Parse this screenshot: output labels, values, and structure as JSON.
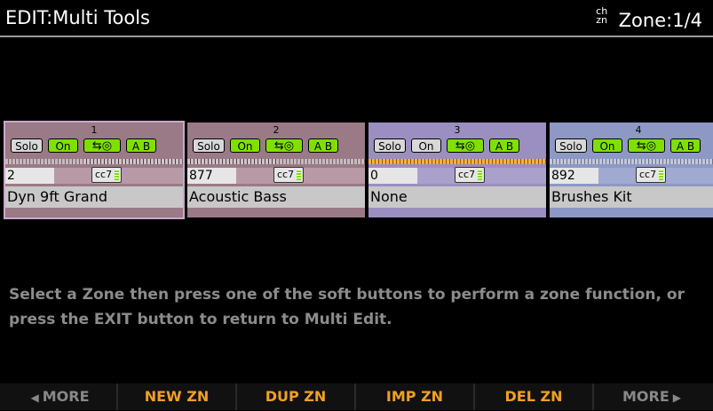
{
  "header": {
    "title": "EDIT:Multi Tools",
    "chan_icon_top": "ch",
    "chan_icon_bottom": "zn",
    "zone_label": "Zone:1/4"
  },
  "zones": [
    {
      "number": "1",
      "solo": "Solo",
      "on": "On",
      "switch_icon": "⇆◎",
      "ab": "A B",
      "program_number": "2",
      "cc": "cc7",
      "program_name": "Dyn 9ft Grand",
      "bg": "#9a7a86",
      "progbar": "#b79aa5",
      "selected": true
    },
    {
      "number": "2",
      "solo": "Solo",
      "on": "On",
      "switch_icon": "⇆◎",
      "ab": "A B",
      "program_number": "877",
      "cc": "cc7",
      "program_name": "Acoustic Bass",
      "bg": "#9a7a86",
      "progbar": "#b89aa6",
      "selected": false
    },
    {
      "number": "3",
      "solo": "Solo",
      "on": "On",
      "switch_icon": "⇆◎",
      "ab": "A B",
      "program_number": "0",
      "cc": "cc7",
      "program_name": "None",
      "bg": "#9a8fc0",
      "progbar": "#aaa0cc",
      "selected": false
    },
    {
      "number": "4",
      "solo": "Solo",
      "on": "On",
      "switch_icon": "⇆◎",
      "ab": "A B",
      "program_number": "892",
      "cc": "cc7",
      "program_name": "Brushes Kit",
      "bg": "#8d98c4",
      "progbar": "#a0aad0",
      "selected": false
    }
  ],
  "message": "Select a Zone then press one of the soft buttons to perform a zone function, or press the EXIT button to return to Multi Edit.",
  "softbuttons": [
    {
      "label": "MORE",
      "arrow": "◀"
    },
    {
      "label": "NEW ZN"
    },
    {
      "label": "DUP ZN"
    },
    {
      "label": "IMP ZN"
    },
    {
      "label": "DEL ZN"
    },
    {
      "label": "MORE",
      "arrow": "▶"
    }
  ],
  "colors": {
    "accent_green": "#7fe000",
    "softkey_orange": "#f0a024",
    "softkey_dim": "#888888"
  }
}
